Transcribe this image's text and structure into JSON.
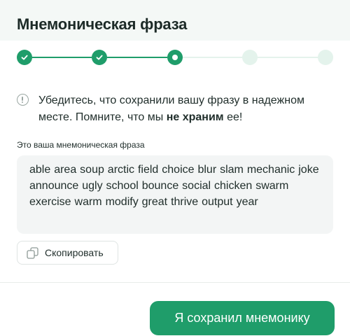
{
  "header": {
    "title": "Мнемоническая фраза"
  },
  "stepper": {
    "steps": [
      {
        "state": "done",
        "icon": "check-icon"
      },
      {
        "state": "done",
        "icon": "check-icon"
      },
      {
        "state": "current",
        "icon": "dot-icon"
      },
      {
        "state": "todo",
        "icon": ""
      },
      {
        "state": "todo",
        "icon": ""
      }
    ],
    "colors": {
      "active": "#1f9d6a",
      "inactive": "#e4f3ec"
    }
  },
  "warning": {
    "icon": "info-icon",
    "text_before": "Убедитесь, что сохранили вашу фразу в надежном месте. Помните, что мы ",
    "text_bold": "не храним",
    "text_after": " ее!"
  },
  "phrase": {
    "label": "Это ваша мнемоническая фраза",
    "words": "able area soup arctic field choice blur slam mechanic joke announce ugly school bounce social chicken swarm exercise warm modify great thrive output year"
  },
  "copy_button": {
    "label": "Скопировать",
    "icon": "copy-icon"
  },
  "confirm_button": {
    "label": "Я сохранил мнемонику"
  },
  "colors": {
    "accent": "#1f9d6a",
    "header_bg": "#f4f8f6",
    "phrase_bg": "#f3f5f5"
  }
}
